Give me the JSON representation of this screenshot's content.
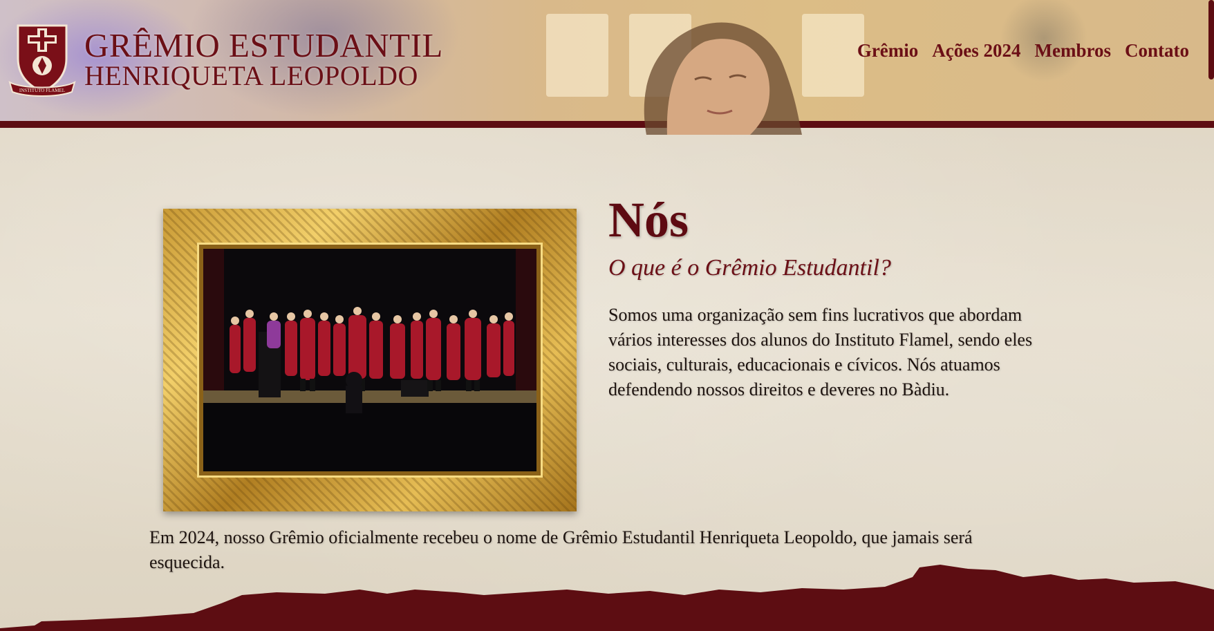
{
  "header": {
    "logo": {
      "line1": "GRÊMIO ESTUDANTIL",
      "line2": "HENRIQUETA LEOPOLDO",
      "crest_ribbon": "INSTITUTO FLAMEL"
    },
    "nav": [
      {
        "label": "Grêmio"
      },
      {
        "label": "Ações 2024"
      },
      {
        "label": "Membros"
      },
      {
        "label": "Contato"
      }
    ]
  },
  "main": {
    "title": "Nós",
    "subtitle": "O que é o Grêmio Estudantil?",
    "body": "Somos uma organização sem fins lucrativos que abordam vários interesses dos alunos do Instituto Flamel, sendo eles sociais, culturais, educacionais e cívicos. Nós atuamos defendendo nossos direitos e deveres no Bàdiu.",
    "footer_text": "Em 2024, nosso Grêmio oficialmente recebeu o nome de Grêmio Estudantil Henriqueta Leopoldo, que jamais será esquecida."
  },
  "colors": {
    "brand": "#6b0f16",
    "brand_dark": "#5d0d12",
    "paper": "#e2d9c8",
    "gold": "#d7ad4a"
  },
  "icons": {
    "crest": "shield-crest-icon"
  }
}
